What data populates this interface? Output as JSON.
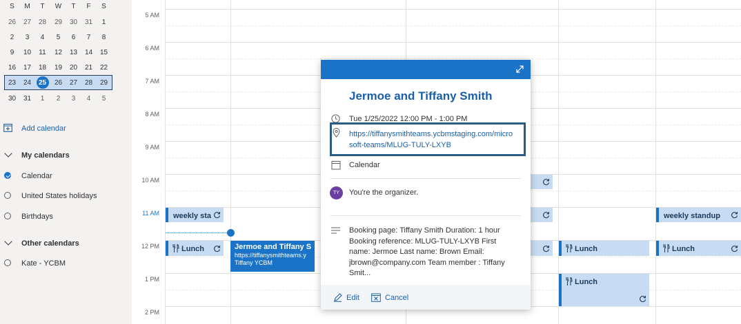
{
  "mini_calendar": {
    "weekday_headers": [
      "S",
      "M",
      "T",
      "W",
      "T",
      "F",
      "S"
    ],
    "weeks": [
      [
        "26",
        "27",
        "28",
        "29",
        "30",
        "31",
        "1"
      ],
      [
        "2",
        "3",
        "4",
        "5",
        "6",
        "7",
        "8"
      ],
      [
        "9",
        "10",
        "11",
        "12",
        "13",
        "14",
        "15"
      ],
      [
        "16",
        "17",
        "18",
        "19",
        "20",
        "21",
        "22"
      ],
      [
        "23",
        "24",
        "25",
        "26",
        "27",
        "28",
        "29"
      ],
      [
        "30",
        "31",
        "1",
        "2",
        "3",
        "4",
        "5"
      ]
    ],
    "today": "25"
  },
  "sidebar": {
    "add_calendar_label": "Add calendar",
    "my_calendars_label": "My calendars",
    "my_calendars": [
      {
        "name": "Calendar",
        "checked": true
      },
      {
        "name": "United States holidays",
        "checked": false
      },
      {
        "name": "Birthdays",
        "checked": false
      }
    ],
    "other_calendars_label": "Other calendars",
    "other_calendars": [
      {
        "name": "Kate - YCBM",
        "checked": false
      }
    ]
  },
  "time_labels": [
    "5 AM",
    "6 AM",
    "7 AM",
    "8 AM",
    "9 AM",
    "10 AM",
    "11 AM",
    "12 PM",
    "1 PM",
    "2 PM"
  ],
  "events": {
    "weekly_standup_1": "weekly sta",
    "weekly_standup_2": "weekly standup",
    "lunch": "Lunch",
    "selected_event_title": "Jermoe and Tiffany S",
    "selected_event_url": "https://tiffanysmithteams.y",
    "selected_event_owner": "Tiffany YCBM"
  },
  "popup": {
    "title": "Jermoe and Tiffany Smith",
    "datetime": "Tue 1/25/2022 12:00 PM - 1:00 PM",
    "location_url": "https://tiffanysmithteams.ycbmstaging.com/microsoft-teams/MLUG-TULY-LXYB",
    "calendar": "Calendar",
    "organizer_initials": "TY",
    "organizer_text": "You're the organizer.",
    "description": "Booking page: Tiffany Smith Duration: 1 hour Booking reference: MLUG-TULY-LXYB  First name: Jermoe Last name: Brown Email: jbrown@company.com Team member : Tiffany Smit...",
    "edit_label": "Edit",
    "cancel_label": "Cancel"
  },
  "colors": {
    "accent": "#1a73c7",
    "event_fill": "#c7dcf2",
    "highlight_border": "#2b5c86"
  }
}
